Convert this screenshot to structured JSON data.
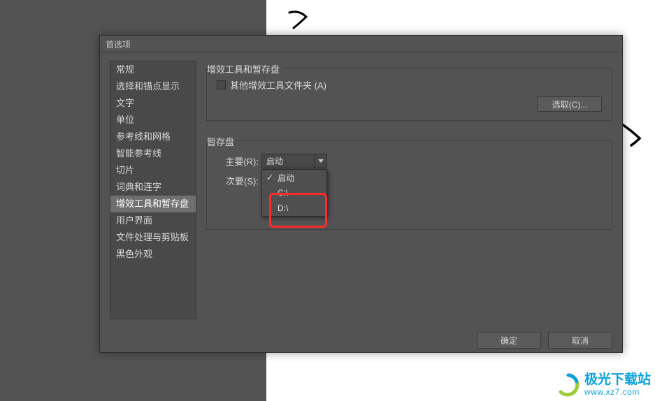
{
  "dialog": {
    "title": "首选项"
  },
  "sidebar": {
    "items": [
      {
        "label": "常规"
      },
      {
        "label": "选择和锚点显示"
      },
      {
        "label": "文字"
      },
      {
        "label": "单位"
      },
      {
        "label": "参考线和网格"
      },
      {
        "label": "智能参考线"
      },
      {
        "label": "切片"
      },
      {
        "label": "词典和连字"
      },
      {
        "label": "增效工具和暂存盘"
      },
      {
        "label": "用户界面"
      },
      {
        "label": "文件处理与剪贴板"
      },
      {
        "label": "黑色外观"
      }
    ],
    "selectedIndex": 8
  },
  "plugins": {
    "title": "增效工具和暂存盘",
    "checkbox_label": "其他增效工具文件夹 (A)",
    "select_button": "选取(C)..."
  },
  "scratch": {
    "title": "暂存盘",
    "primary_label": "主要(R):",
    "secondary_label": "次要(S):",
    "primary_value": "启动",
    "options": [
      {
        "label": "启动",
        "checked": true
      },
      {
        "label": "C:\\",
        "checked": false
      },
      {
        "label": "D:\\",
        "checked": false
      }
    ]
  },
  "footer": {
    "ok": "确定",
    "cancel": "取消"
  },
  "watermark": {
    "main": "极光下载站",
    "sub": "www.xz7.com"
  }
}
